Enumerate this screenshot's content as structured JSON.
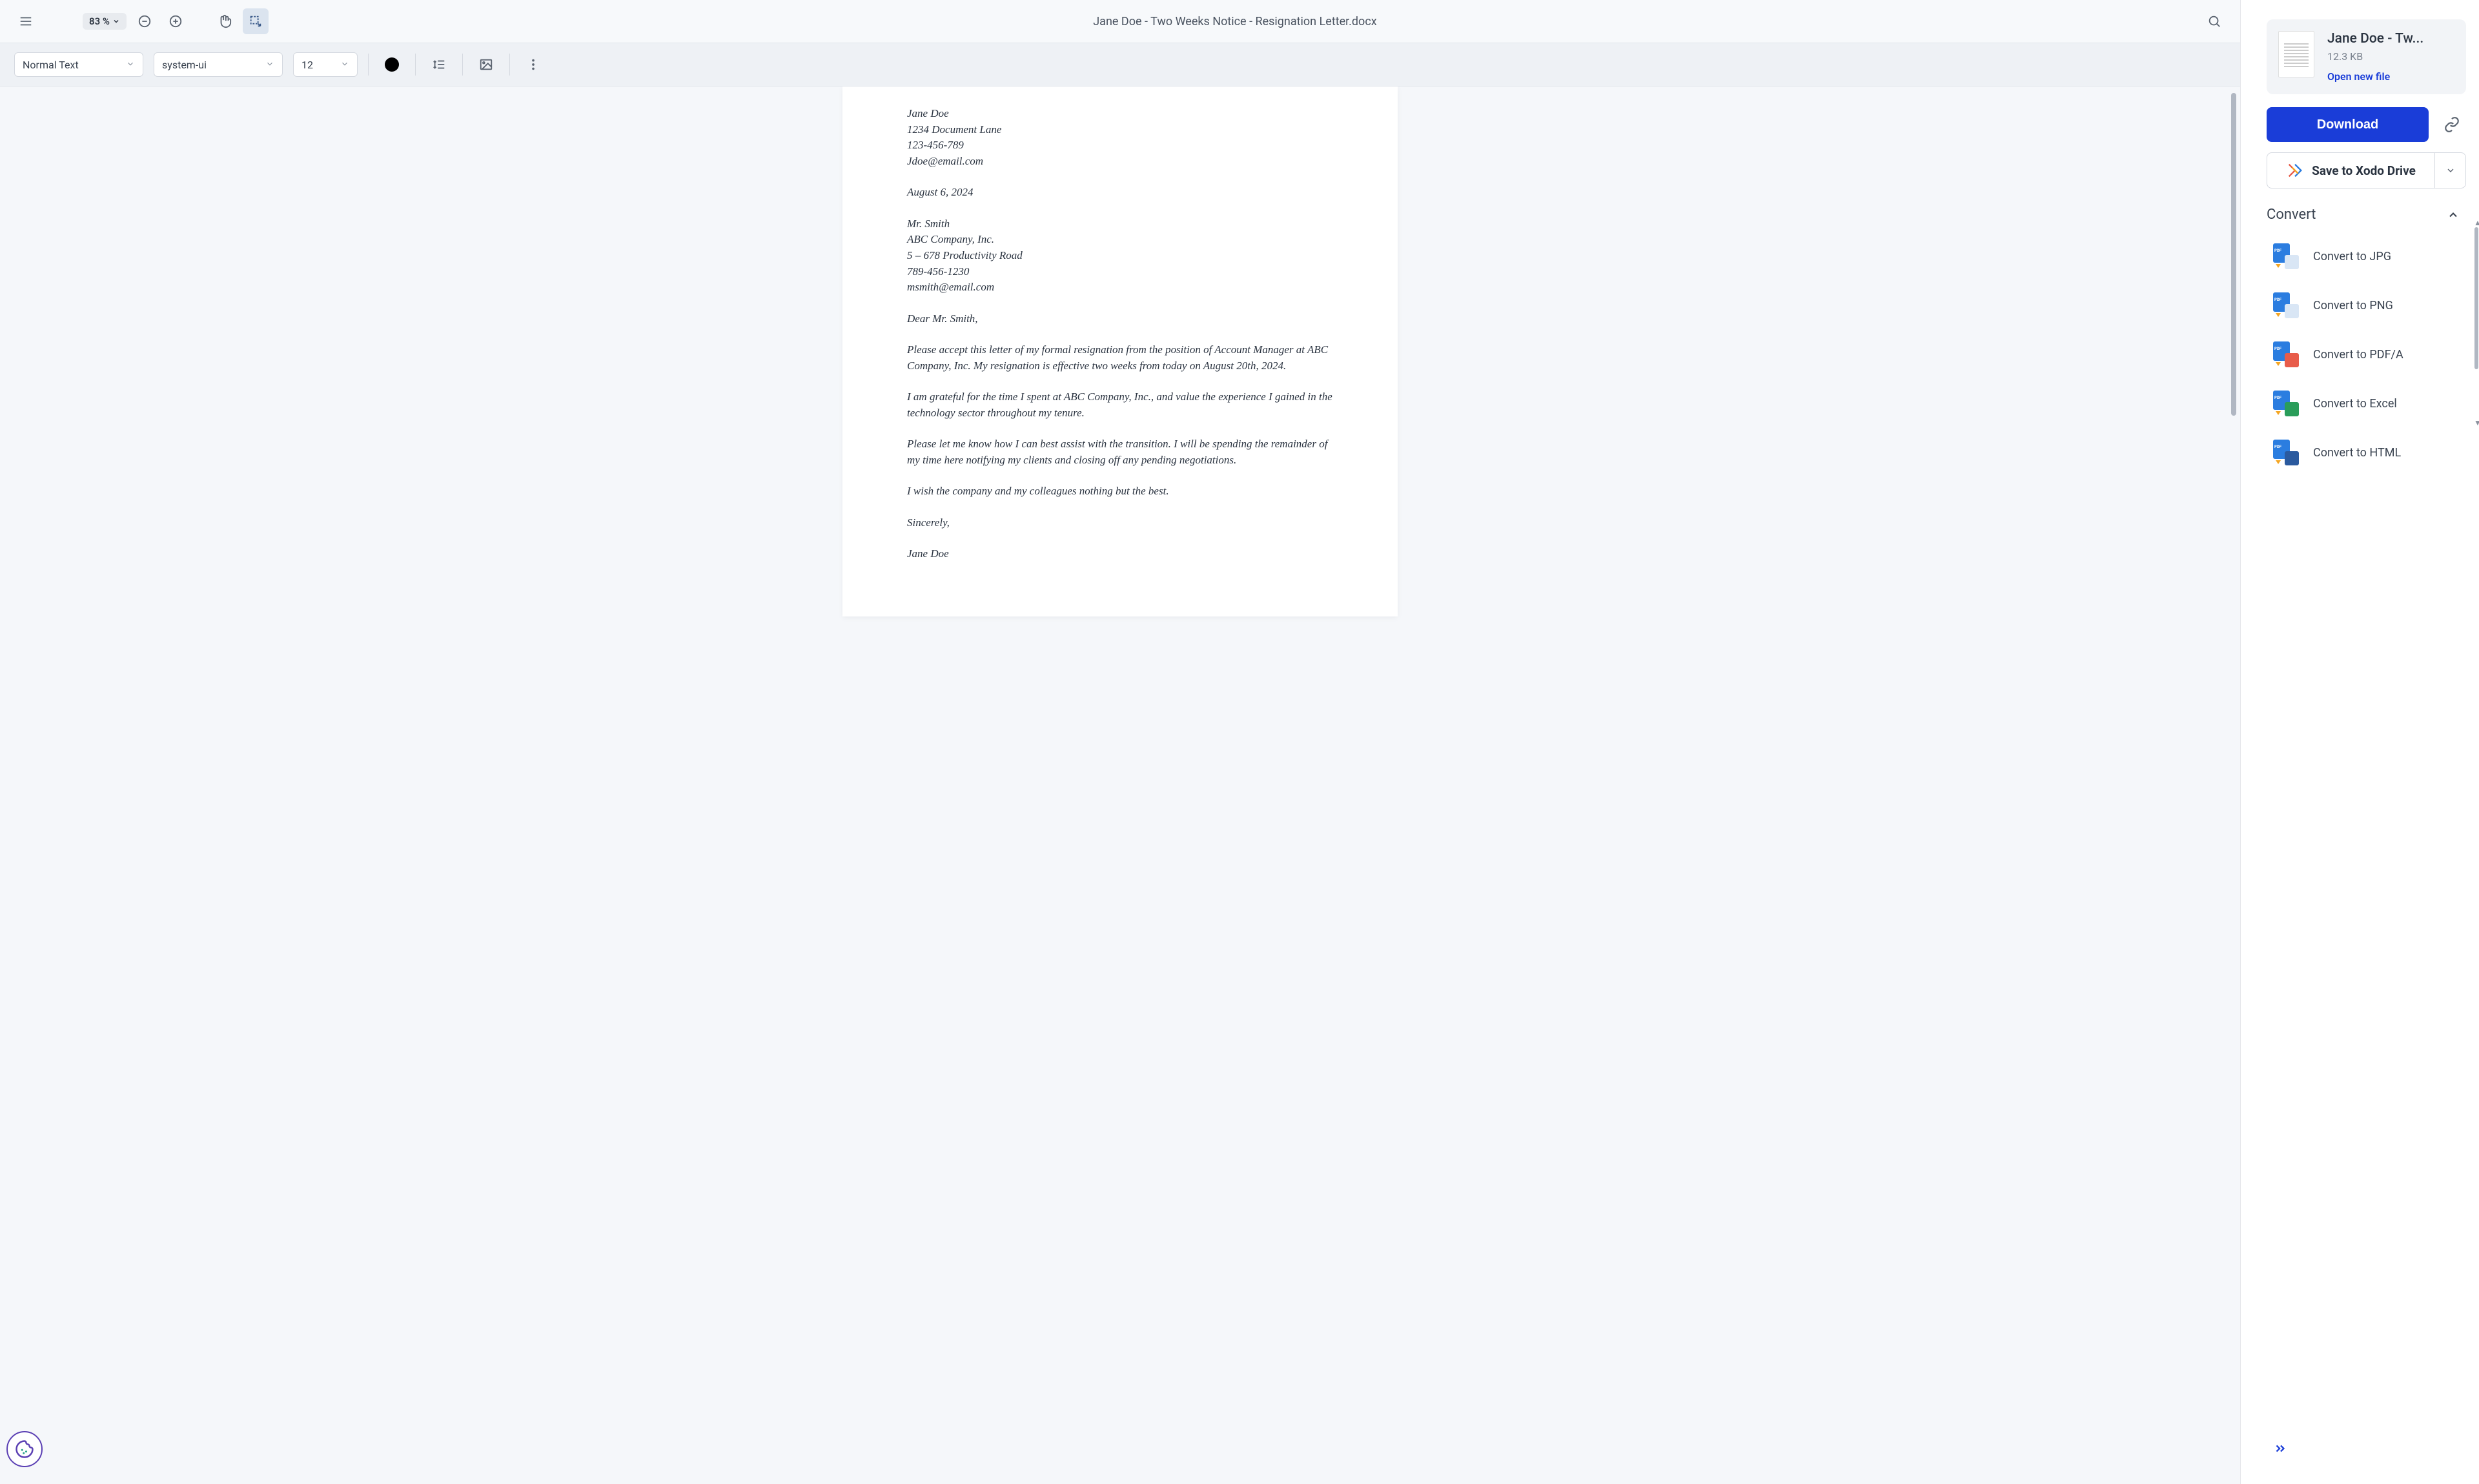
{
  "topbar": {
    "zoom": "83 %",
    "doc_title": "Jane Doe - Two Weeks Notice - Resignation Letter.docx"
  },
  "fmtbar": {
    "style": "Normal Text",
    "font": "system-ui",
    "size": "12"
  },
  "document": {
    "sender_name": "Jane Doe",
    "sender_addr": "1234 Document Lane",
    "sender_phone": "123-456-789",
    "sender_email": "Jdoe@email.com",
    "date": "August 6, 2024",
    "recipient_name": "Mr. Smith",
    "recipient_company": "ABC Company, Inc.",
    "recipient_addr": "5 – 678 Productivity Road",
    "recipient_phone": "789-456-1230",
    "recipient_email": "msmith@email.com",
    "salutation": "Dear Mr. Smith,",
    "p1": "Please accept this letter of my formal resignation from the position of Account Manager at ABC Company, Inc. My resignation is effective two weeks from today on August 20th, 2024.",
    "p2": "I am grateful for the time I spent at ABC Company, Inc., and value the experience I gained in the technology sector throughout my tenure.",
    "p3": "Please let me know how I can best assist with the transition. I will be spending the remainder of my time here notifying my clients and closing off any pending negotiations.",
    "p4": "I wish the company and my colleagues nothing but the best.",
    "closing": "Sincerely,",
    "signature": "Jane Doe"
  },
  "sidebar": {
    "file_name": "Jane Doe - Tw...",
    "file_size": "12.3 KB",
    "open_new": "Open new file",
    "download": "Download",
    "save": "Save to Xodo Drive",
    "convert_hdr": "Convert",
    "convert": [
      {
        "label": "Convert to JPG"
      },
      {
        "label": "Convert to PNG"
      },
      {
        "label": "Convert to PDF/A"
      },
      {
        "label": "Convert to Excel"
      },
      {
        "label": "Convert to HTML"
      }
    ]
  }
}
